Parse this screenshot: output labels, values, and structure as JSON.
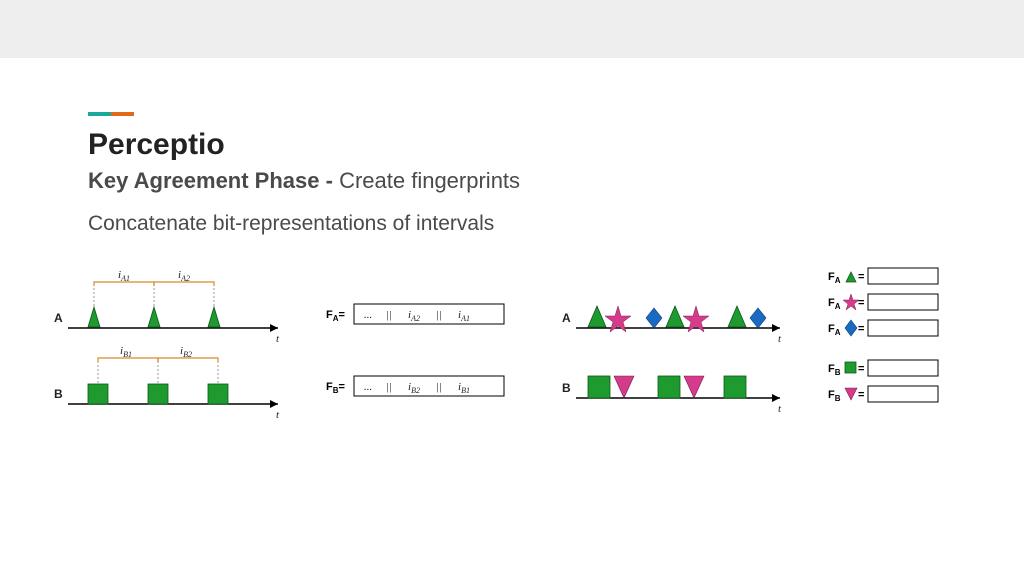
{
  "header": {
    "title": "Perceptio",
    "subtitle_strong": "Key Agreement Phase - ",
    "subtitle_rest": "Create fingerprints"
  },
  "body": {
    "line": "Concatenate bit-representations of intervals"
  },
  "panel1": {
    "rowA": "A",
    "rowB": "B",
    "t": "t",
    "iA1": "i",
    "iA1sub": "A1",
    "iA2": "i",
    "iA2sub": "A2",
    "iB1": "i",
    "iB1sub": "B1",
    "iB2": "i",
    "iB2sub": "B2"
  },
  "panel2": {
    "FA": "F",
    "FAsub": "A",
    "eq": "=",
    "FB": "F",
    "FBsub": "B",
    "dots": "...",
    "bars": "||",
    "iA2": "i",
    "iA2sub": "A2",
    "iA1": "i",
    "iA1sub": "A1",
    "iB2": "i",
    "iB2sub": "B2",
    "iB1": "i",
    "iB1sub": "B1"
  },
  "panel3": {
    "rowA": "A",
    "rowB": "B",
    "t": "t"
  },
  "panel4": {
    "F": "F",
    "A": "A",
    "B": "B",
    "eq": "="
  }
}
